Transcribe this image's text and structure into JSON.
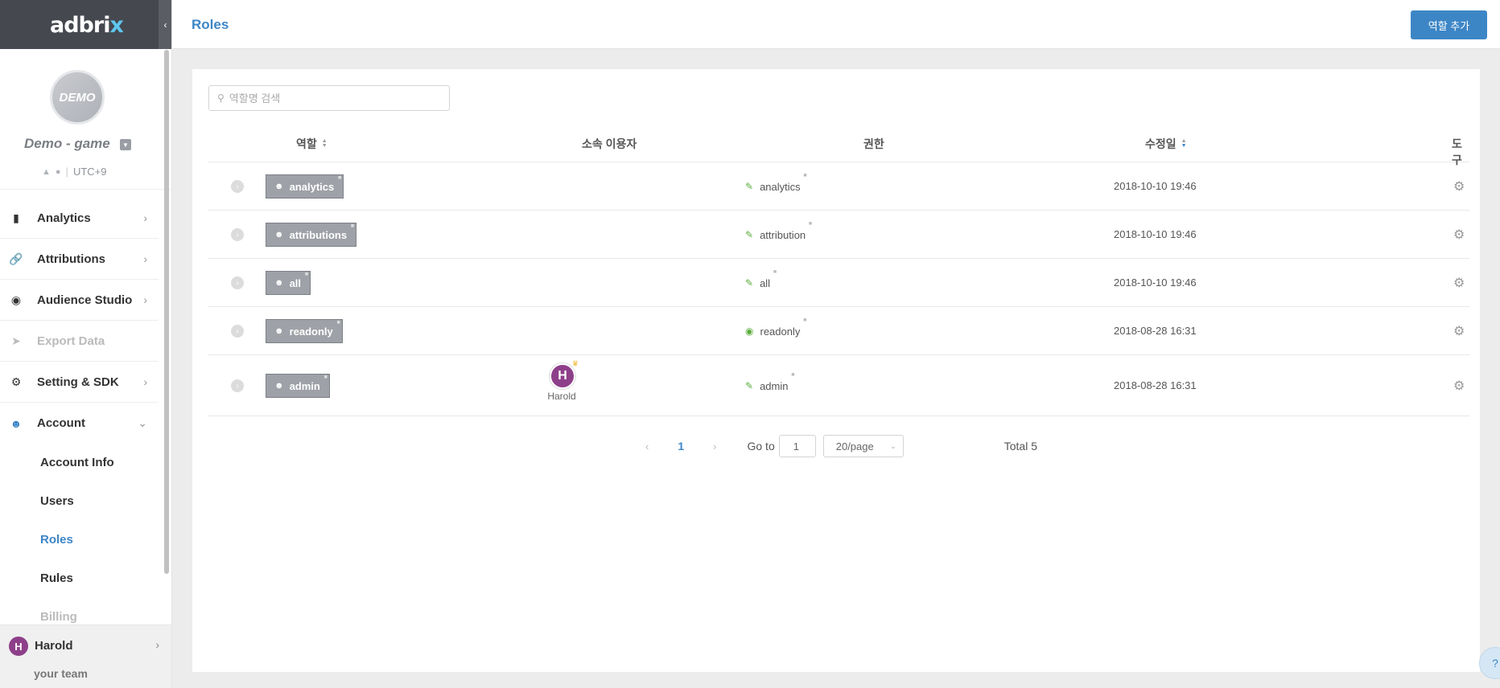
{
  "sidebar": {
    "logo": "adbri",
    "logo_x": "x",
    "collapse_icon": "‹",
    "app": {
      "avatar_text": "DEMO",
      "name": "Demo - game",
      "timezone": "UTC+9"
    },
    "nav": [
      {
        "label": "Analytics",
        "icon": "bar-chart-icon"
      },
      {
        "label": "Attributions",
        "icon": "link-icon"
      },
      {
        "label": "Audience Studio",
        "icon": "audience-icon"
      },
      {
        "label": "Export Data",
        "icon": "export-icon"
      },
      {
        "label": "Setting & SDK",
        "icon": "gear-icon"
      },
      {
        "label": "Account",
        "icon": "users-icon"
      }
    ],
    "account_sub": [
      {
        "label": "Account Info"
      },
      {
        "label": "Users"
      },
      {
        "label": "Roles"
      },
      {
        "label": "Rules"
      },
      {
        "label": "Billing"
      }
    ],
    "user": {
      "initial": "H",
      "name": "Harold",
      "team": "your team"
    }
  },
  "header": {
    "title": "Roles",
    "add_button": "역할 추가"
  },
  "search": {
    "placeholder": "역할명 검색"
  },
  "table": {
    "columns": {
      "role": "역할",
      "members": "소속 이용자",
      "permission": "권한",
      "modified": "수정일",
      "tools": "도구"
    },
    "rows": [
      {
        "role": "analytics",
        "permission": "analytics",
        "permission_icon": "edit-icon",
        "modified": "2018-10-10 19:46"
      },
      {
        "role": "attributions",
        "permission": "attribution",
        "permission_icon": "edit-icon",
        "modified": "2018-10-10 19:46"
      },
      {
        "role": "all",
        "permission": "all",
        "permission_icon": "edit-icon",
        "modified": "2018-10-10 19:46"
      },
      {
        "role": "readonly",
        "permission": "readonly",
        "permission_icon": "eye-icon",
        "modified": "2018-08-28 16:31"
      },
      {
        "role": "admin",
        "permission": "admin",
        "permission_icon": "edit-icon",
        "modified": "2018-08-28 16:31",
        "member": {
          "initial": "H",
          "name": "Harold"
        }
      }
    ]
  },
  "pagination": {
    "current_page": "1",
    "goto_label": "Go to",
    "goto_value": "1",
    "page_size": "20/page",
    "total": "Total 5"
  },
  "colors": {
    "accent": "#3d86c6",
    "sidebar_header": "#45484f",
    "role_tag": "#9ea1a7",
    "avatar": "#8e3f8a",
    "permission_icon": "#5cae3e"
  }
}
